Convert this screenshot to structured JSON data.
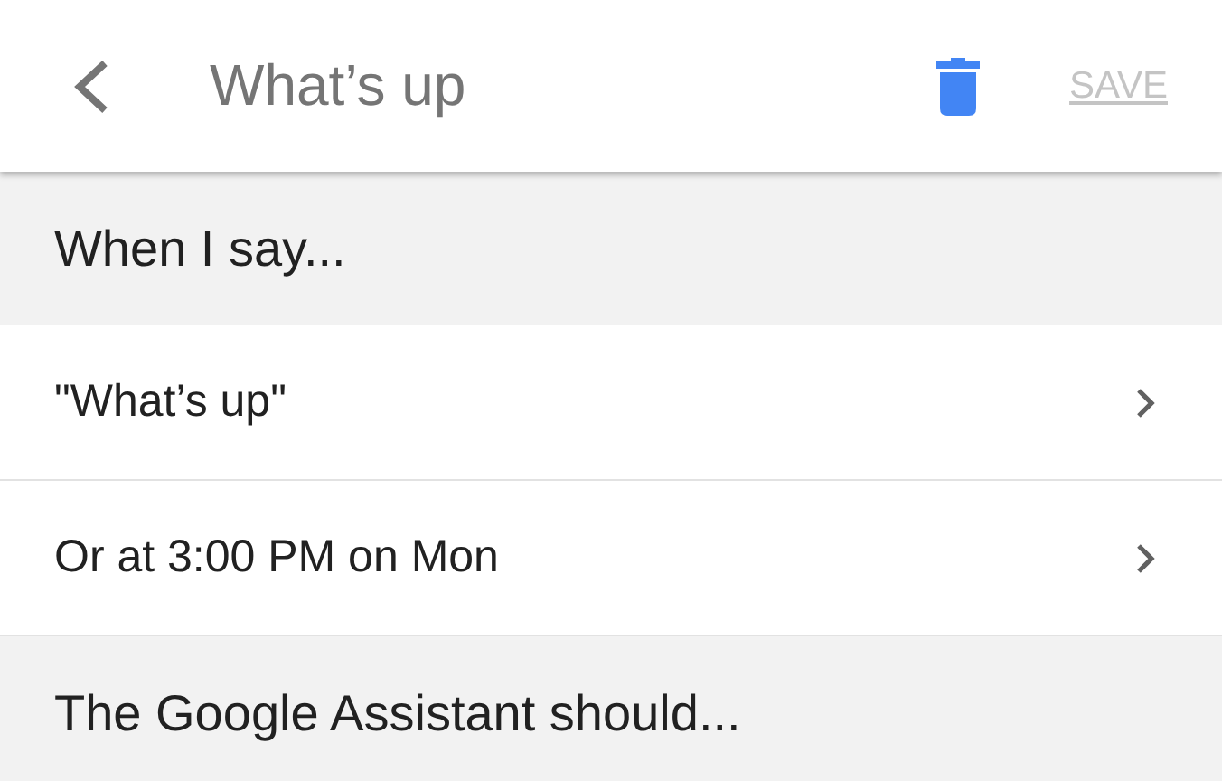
{
  "header": {
    "title": "What’s up",
    "save": {
      "label": "SAVE",
      "disabled": true
    }
  },
  "sections": [
    {
      "title": "When I say...",
      "rows": [
        {
          "label": "\"What’s up\""
        },
        {
          "label": "Or at 3:00 PM on Mon"
        }
      ]
    },
    {
      "title": "The Google Assistant should..."
    }
  ]
}
